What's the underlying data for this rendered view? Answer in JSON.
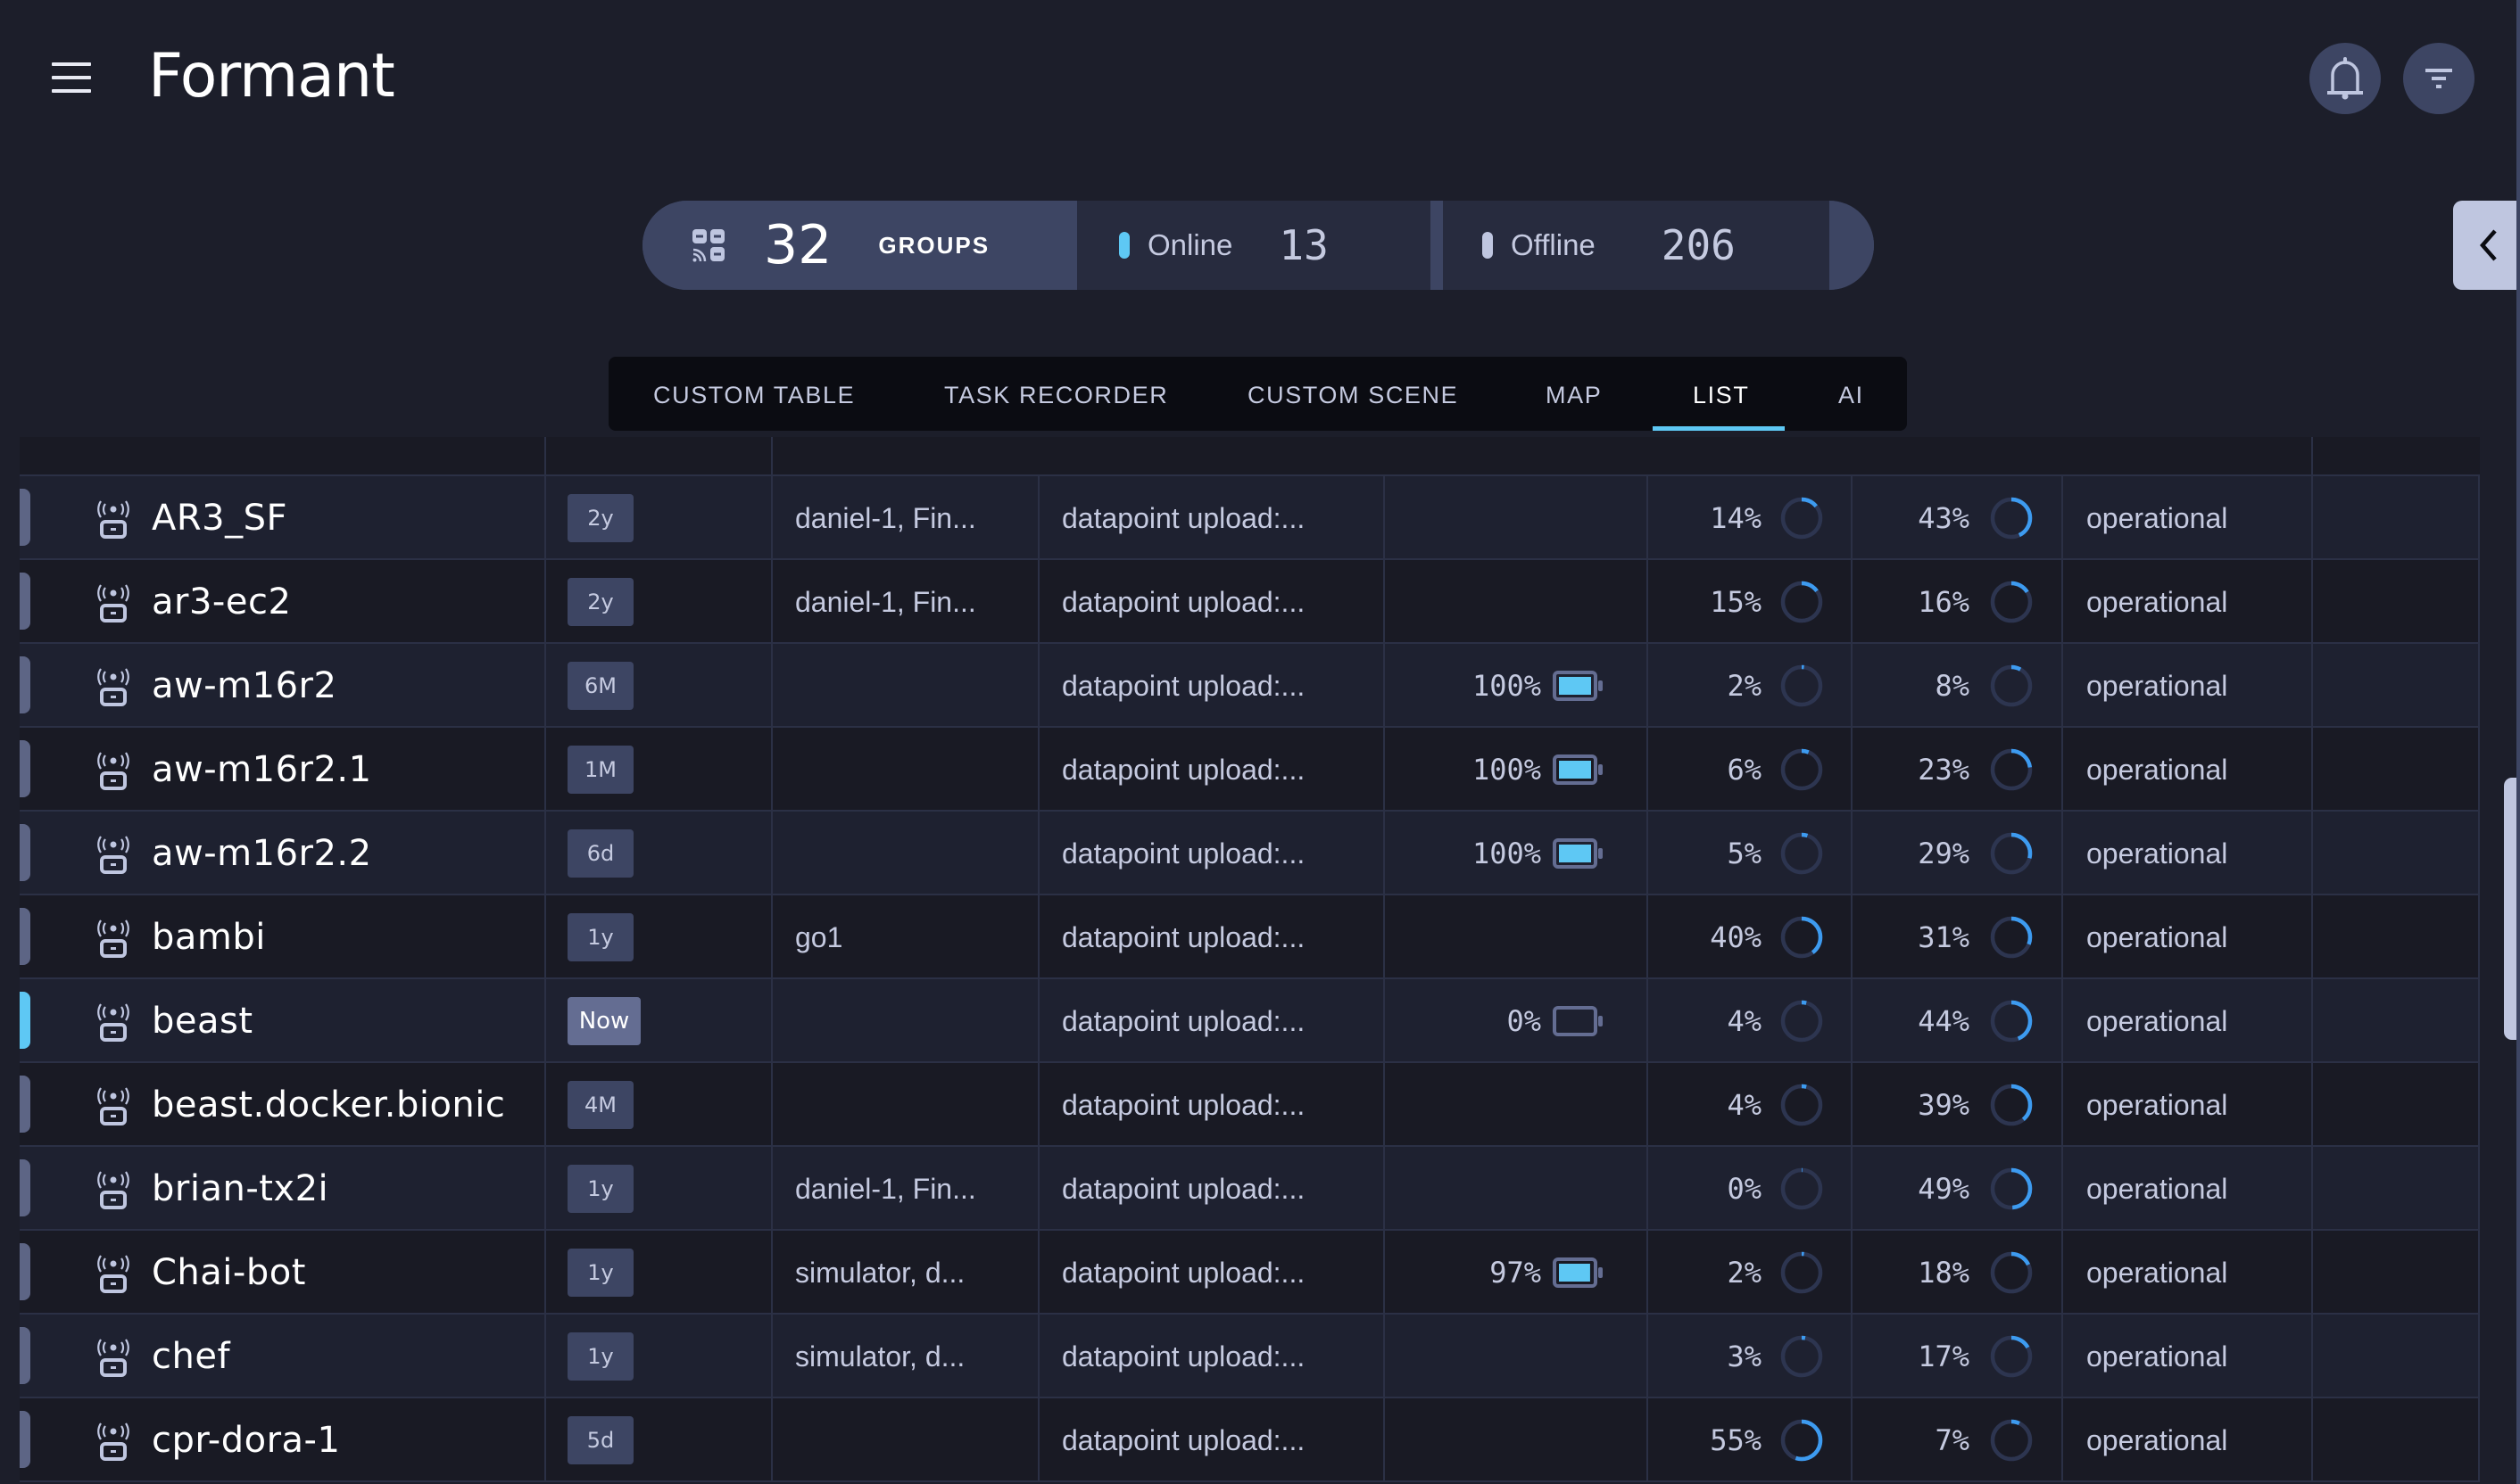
{
  "header": {
    "logo": "Formant",
    "menu_icon": "hamburger-menu-icon",
    "notifications_icon": "bell-icon",
    "filter_icon": "filter-icon"
  },
  "stats": {
    "groups_icon": "groups-icon",
    "groups_count": "32",
    "groups_label": "GROUPS",
    "online_label": "Online",
    "online_count": "13",
    "offline_label": "Offline",
    "offline_count": "206",
    "online_color": "#5ec8f4",
    "offline_color": "#bfc6e0"
  },
  "side_toggle_icon": "chevron-left-icon",
  "tabs": [
    {
      "label": "CUSTOM TABLE",
      "active": false
    },
    {
      "label": "TASK RECORDER",
      "active": false
    },
    {
      "label": "CUSTOM SCENE",
      "active": false
    },
    {
      "label": "MAP",
      "active": false
    },
    {
      "label": "LIST",
      "active": true
    },
    {
      "label": "AI",
      "active": false
    }
  ],
  "colors": {
    "accent": "#5ec8f4",
    "ring_fill": "#3d9bf0",
    "ring_track": "#2d3550",
    "badge": "#3d4563",
    "badge_now": "#646d92"
  },
  "devices": [
    {
      "name": "AR3_SF",
      "age": "2y",
      "tags": "daniel-1, Fin...",
      "status": "datapoint upload:...",
      "battery": null,
      "cpu": 14,
      "memory": 43,
      "state": "operational",
      "online": false
    },
    {
      "name": "ar3-ec2",
      "age": "2y",
      "tags": "daniel-1, Fin...",
      "status": "datapoint upload:...",
      "battery": null,
      "cpu": 15,
      "memory": 16,
      "state": "operational",
      "online": false
    },
    {
      "name": "aw-m16r2",
      "age": "6M",
      "tags": "",
      "status": "datapoint upload:...",
      "battery": 100,
      "cpu": 2,
      "memory": 8,
      "state": "operational",
      "online": false
    },
    {
      "name": "aw-m16r2.1",
      "age": "1M",
      "tags": "",
      "status": "datapoint upload:...",
      "battery": 100,
      "cpu": 6,
      "memory": 23,
      "state": "operational",
      "online": false
    },
    {
      "name": "aw-m16r2.2",
      "age": "6d",
      "tags": "",
      "status": "datapoint upload:...",
      "battery": 100,
      "cpu": 5,
      "memory": 29,
      "state": "operational",
      "online": false
    },
    {
      "name": "bambi",
      "age": "1y",
      "tags": "go1",
      "status": "datapoint upload:...",
      "battery": null,
      "cpu": 40,
      "memory": 31,
      "state": "operational",
      "online": false
    },
    {
      "name": "beast",
      "age": "Now",
      "tags": "",
      "status": "datapoint upload:...",
      "battery": 0,
      "cpu": 4,
      "memory": 44,
      "state": "operational",
      "online": true
    },
    {
      "name": "beast.docker.bionic",
      "age": "4M",
      "tags": "",
      "status": "datapoint upload:...",
      "battery": null,
      "cpu": 4,
      "memory": 39,
      "state": "operational",
      "online": false
    },
    {
      "name": "brian-tx2i",
      "age": "1y",
      "tags": "daniel-1, Fin...",
      "status": "datapoint upload:...",
      "battery": null,
      "cpu": 0,
      "memory": 49,
      "state": "operational",
      "online": false
    },
    {
      "name": "Chai-bot",
      "age": "1y",
      "tags": "simulator, d...",
      "status": "datapoint upload:...",
      "battery": 97,
      "cpu": 2,
      "memory": 18,
      "state": "operational",
      "online": false
    },
    {
      "name": "chef",
      "age": "1y",
      "tags": "simulator, d...",
      "status": "datapoint upload:...",
      "battery": null,
      "cpu": 3,
      "memory": 17,
      "state": "operational",
      "online": false
    },
    {
      "name": "cpr-dora-1",
      "age": "5d",
      "tags": "",
      "status": "datapoint upload:...",
      "battery": null,
      "cpu": 55,
      "memory": 7,
      "state": "operational",
      "online": false
    }
  ]
}
